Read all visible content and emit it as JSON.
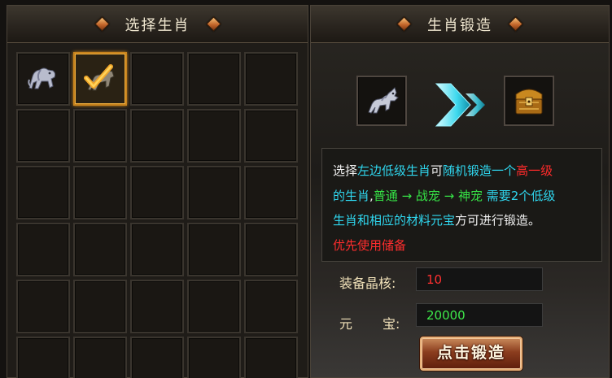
{
  "left_panel": {
    "title": "选择生肖"
  },
  "right_panel": {
    "title": "生肖锻造"
  },
  "zodiac_grid": {
    "slots": [
      {
        "item": "lion-zodiac",
        "selected": false
      },
      {
        "item": "horse-zodiac-checked",
        "selected": true
      }
    ]
  },
  "forge": {
    "source_item": "horse-zodiac-icon",
    "result_item": "golden-chest-icon"
  },
  "description": {
    "parts": [
      {
        "text": "选择",
        "color": "white"
      },
      {
        "text": "左边低级生肖",
        "color": "cyan"
      },
      {
        "text": "可",
        "color": "white"
      },
      {
        "text": "随机锻造一个",
        "color": "cyan"
      },
      {
        "text": "高一级",
        "color": "red"
      },
      {
        "text": "的生肖",
        "color": "cyan"
      },
      {
        "text": ",",
        "color": "white"
      },
      {
        "text": "普通 → 战宠 → 神宠",
        "color": "green"
      },
      {
        "text": " 需要2个低级",
        "color": "cyan"
      },
      {
        "text": "生肖和相应的材料元宝",
        "color": "cyan"
      },
      {
        "text": "方可进行锻造。",
        "color": "white"
      }
    ],
    "warning": "优先使用储备"
  },
  "materials": {
    "core_label": "装备晶核:",
    "core_value": "10",
    "core_color": "#ff3030",
    "yuanbao_label_1": "元",
    "yuanbao_label_2": "宝:",
    "yuanbao_value": "20000",
    "yuanbao_color": "#3ee84a"
  },
  "forge_button": {
    "label": "点击锻造"
  }
}
